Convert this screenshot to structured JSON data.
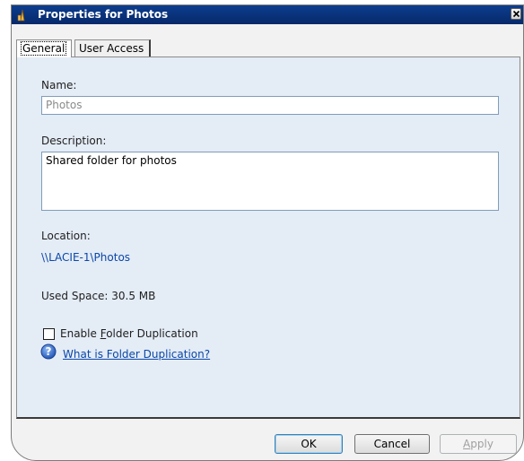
{
  "window": {
    "title": "Properties for Photos"
  },
  "tabs": [
    {
      "label": "General",
      "active": true
    },
    {
      "label": "User Access",
      "active": false
    }
  ],
  "general": {
    "name_label": "Name:",
    "name_value": "Photos",
    "description_label": "Description:",
    "description_value": "Shared folder for photos",
    "location_label": "Location:",
    "location_value": "\\\\LACIE-1\\Photos",
    "used_space": "Used Space: 30.5 MB",
    "duplication_checkbox": {
      "label_before": "Enable ",
      "label_mnemonic": "F",
      "label_after": "older Duplication",
      "checked": false
    },
    "help_link_mnemonic": "W",
    "help_link_rest": "hat is Folder Duplication?"
  },
  "buttons": {
    "ok": "OK",
    "cancel": "Cancel",
    "apply_mnemonic": "A",
    "apply_rest": "pply"
  },
  "icons": {
    "app": "folder-share-icon",
    "close": "close-icon",
    "help": "help-icon"
  },
  "colors": {
    "titlebar": "#0a3580",
    "panel_background": "#e4ecf6",
    "link": "#0b47a8"
  }
}
